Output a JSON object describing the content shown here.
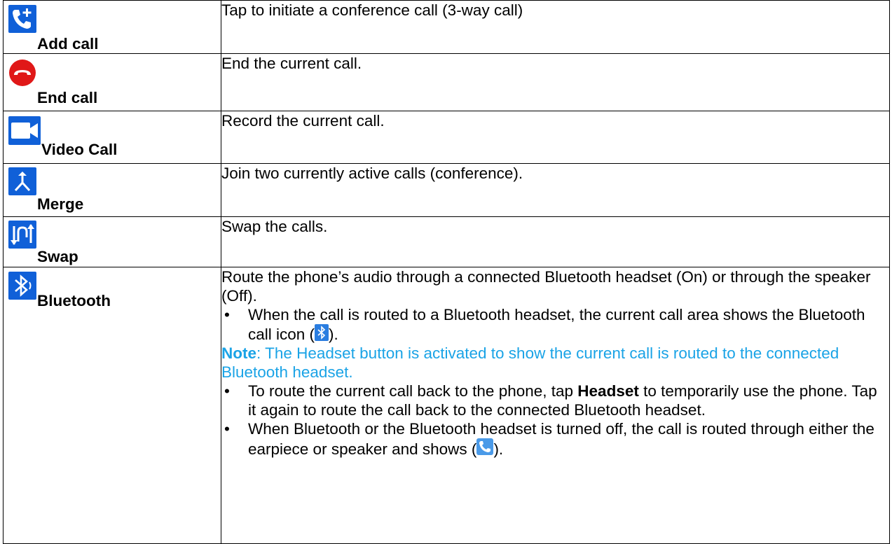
{
  "rows": [
    {
      "icon": "add-call-icon",
      "name": "Add call",
      "description": "Tap to initiate a conference call (3-way call)"
    },
    {
      "icon": "end-call-icon",
      "name": "End call",
      "description": "End the current call."
    },
    {
      "icon": "video-call-icon",
      "name": "Video Call",
      "description": "Record the current call."
    },
    {
      "icon": "merge-icon",
      "name": "Merge",
      "description": "Join two currently active calls (conference)."
    },
    {
      "icon": "swap-icon",
      "name": "Swap",
      "description": "Swap the calls."
    }
  ],
  "bluetooth": {
    "icon": "bluetooth-icon",
    "name": "Bluetooth",
    "intro": "Route the phone’s audio through a connected Bluetooth headset (On) or through the speaker (Off).",
    "bullet_char": "•",
    "bullet1_a": "When the call is routed to a Bluetooth headset, the current call area shows the Bluetooth call icon (",
    "bullet1_b": ").",
    "note_label": "Note",
    "note_text": ": The Headset button is activated to show the current call is routed to the connected Bluetooth headset.",
    "bullet2_a": "To route the current call back to the phone, tap ",
    "bullet2_bold": "Headset",
    "bullet2_b": " to temporarily use the phone. Tap it again to route the call back to the connected Bluetooth headset.",
    "bullet3_a": "When Bluetooth or the Bluetooth headset is turned off, the call is routed through either the earpiece or speaker and shows (",
    "bullet3_b": ")."
  },
  "colors": {
    "icon_blue": "#1060d8",
    "end_call_red": "#e01818",
    "note_blue": "#1aa3e6"
  }
}
